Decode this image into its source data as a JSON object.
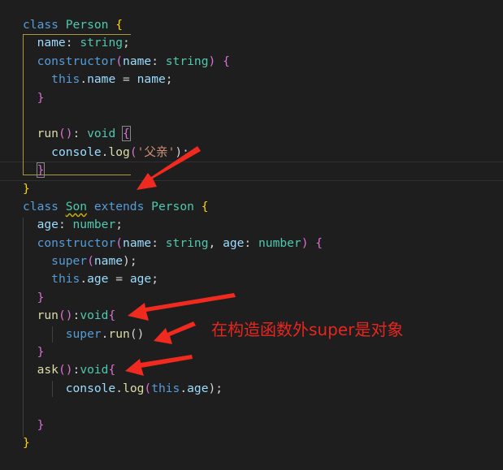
{
  "editor": {
    "lines": [
      [
        [
          "class ",
          "kw"
        ],
        [
          "Person ",
          "ty"
        ],
        [
          "{",
          "b1"
        ]
      ],
      [
        [
          "  "
        ],
        [
          "name",
          "va"
        ],
        [
          ": ",
          "pl"
        ],
        [
          "string",
          "ty"
        ],
        [
          ";",
          "pl"
        ]
      ],
      [
        [
          "  "
        ],
        [
          "constructor",
          "kw"
        ],
        [
          "(",
          "b2"
        ],
        [
          "name",
          "va"
        ],
        [
          ": ",
          "pl"
        ],
        [
          "string",
          "ty"
        ],
        [
          ") ",
          "b2"
        ],
        [
          "{",
          "b2"
        ]
      ],
      [
        [
          "    "
        ],
        [
          "this",
          "kw"
        ],
        [
          ".",
          "pl"
        ],
        [
          "name",
          "va"
        ],
        [
          " = ",
          "pl"
        ],
        [
          "name",
          "va"
        ],
        [
          ";",
          "pl"
        ]
      ],
      [
        [
          "  "
        ],
        [
          "}",
          "b2"
        ]
      ],
      [
        [
          ""
        ]
      ],
      [
        [
          "  "
        ],
        [
          "run",
          "fn"
        ],
        [
          "()",
          "b2"
        ],
        [
          ": ",
          "pl"
        ],
        [
          "void ",
          "ty"
        ],
        [
          "{",
          "b2 bx"
        ]
      ],
      [
        [
          "    "
        ],
        [
          "console",
          "va"
        ],
        [
          ".",
          "pl"
        ],
        [
          "log",
          "fn"
        ],
        [
          "(",
          "b2"
        ],
        [
          "'父亲'",
          "st"
        ],
        [
          ");",
          "pl"
        ]
      ],
      [
        [
          "  "
        ],
        [
          "}",
          "b2 bx"
        ]
      ],
      [
        [
          "}",
          "b1"
        ]
      ],
      [
        [
          "class ",
          "kw"
        ],
        [
          "Son",
          "ty sq"
        ],
        [
          " "
        ],
        [
          "extends ",
          "kw"
        ],
        [
          "Person ",
          "ty"
        ],
        [
          "{",
          "b1"
        ]
      ],
      [
        [
          "  "
        ],
        [
          "age",
          "va"
        ],
        [
          ": ",
          "pl"
        ],
        [
          "number",
          "ty"
        ],
        [
          ";",
          "pl"
        ]
      ],
      [
        [
          "  "
        ],
        [
          "constructor",
          "kw"
        ],
        [
          "(",
          "b2"
        ],
        [
          "name",
          "va"
        ],
        [
          ": ",
          "pl"
        ],
        [
          "string",
          "ty"
        ],
        [
          ", ",
          "pl"
        ],
        [
          "age",
          "va"
        ],
        [
          ": ",
          "pl"
        ],
        [
          "number",
          "ty"
        ],
        [
          ") ",
          "b2"
        ],
        [
          "{",
          "b2"
        ]
      ],
      [
        [
          "    "
        ],
        [
          "super",
          "kw"
        ],
        [
          "(",
          "b2"
        ],
        [
          "name",
          "va"
        ],
        [
          ");",
          "pl"
        ]
      ],
      [
        [
          "    "
        ],
        [
          "this",
          "kw"
        ],
        [
          ".",
          "pl"
        ],
        [
          "age",
          "va"
        ],
        [
          " = ",
          "pl"
        ],
        [
          "age",
          "va"
        ],
        [
          ";",
          "pl"
        ]
      ],
      [
        [
          "  "
        ],
        [
          "}",
          "b2"
        ]
      ],
      [
        [
          "  "
        ],
        [
          "run",
          "fn"
        ],
        [
          "()",
          "b2"
        ],
        [
          ":",
          "pl"
        ],
        [
          "void",
          "ty"
        ],
        [
          "{",
          "b2"
        ]
      ],
      [
        [
          "      "
        ],
        [
          "super",
          "kw"
        ],
        [
          ".",
          "pl"
        ],
        [
          "run",
          "fn"
        ],
        [
          "()",
          "pl"
        ]
      ],
      [
        [
          "  "
        ],
        [
          "}",
          "b2"
        ]
      ],
      [
        [
          "  "
        ],
        [
          "ask",
          "fn"
        ],
        [
          "()",
          "b2"
        ],
        [
          ":",
          "pl"
        ],
        [
          "void",
          "ty"
        ],
        [
          "{",
          "b2"
        ]
      ],
      [
        [
          "      "
        ],
        [
          "console",
          "va"
        ],
        [
          ".",
          "pl"
        ],
        [
          "log",
          "fn"
        ],
        [
          "(",
          "b2"
        ],
        [
          "this",
          "kw"
        ],
        [
          ".",
          "pl"
        ],
        [
          "age",
          "va"
        ],
        [
          ");",
          "pl"
        ]
      ],
      [
        [
          ""
        ]
      ],
      [
        [
          "  "
        ],
        [
          "}",
          "b2"
        ]
      ],
      [
        [
          "}",
          "b1"
        ]
      ]
    ]
  },
  "annotation": {
    "text": "在构造函数外super是对象",
    "color": "#e8251f"
  },
  "colors": {
    "background": "#1e1e1e",
    "arrow": "#f02a1e"
  }
}
